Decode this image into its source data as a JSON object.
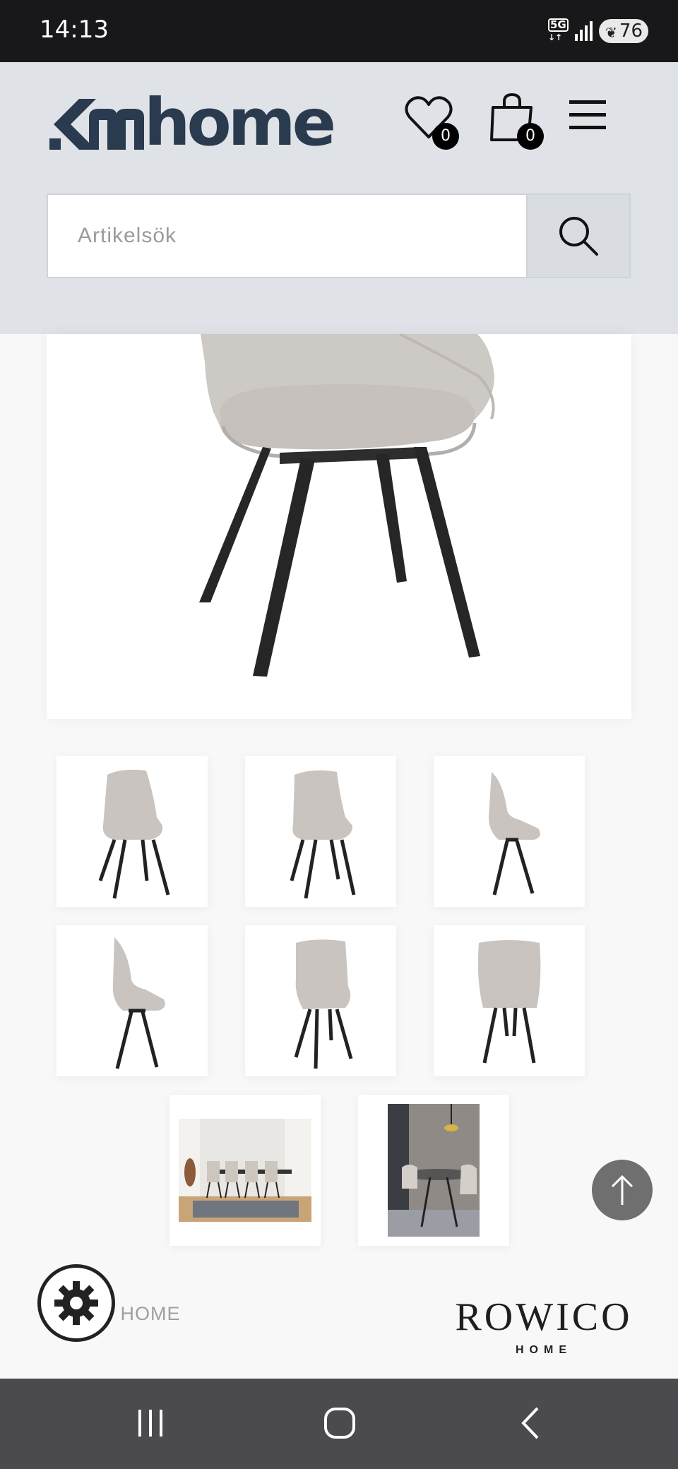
{
  "status_bar": {
    "time": "14:13",
    "network": "5G",
    "battery": "76"
  },
  "header": {
    "logo_text": "home",
    "wishlist_count": "0",
    "cart_count": "0",
    "search": {
      "placeholder": "Artikelsök",
      "value": ""
    }
  },
  "product": {
    "main_image": "chair-main-image",
    "thumbnails": [
      {
        "name": "chair-front-angle"
      },
      {
        "name": "chair-front-angle-2"
      },
      {
        "name": "chair-side"
      },
      {
        "name": "chair-side-2"
      },
      {
        "name": "chair-back-angle"
      },
      {
        "name": "chair-back"
      },
      {
        "name": "dining-room-scene"
      },
      {
        "name": "dining-room-scene-2"
      }
    ]
  },
  "footer": {
    "brand_text_partial": "O HOME",
    "rowico_logo": "ROWICO",
    "rowico_sub": "HOME"
  },
  "icons": {
    "wishlist": "heart-icon",
    "cart": "shopping-bag-icon",
    "menu": "hamburger-menu-icon",
    "search": "search-icon",
    "scroll_top": "arrow-up-icon",
    "settings": "gear-icon"
  },
  "colors": {
    "header_bg": "#dfe2e7",
    "logo": "#2a3a4f",
    "status_bar_bg": "#18181a",
    "nav_bar_bg": "#4b4b4f",
    "scroll_top_bg": "#6f6f6f"
  }
}
